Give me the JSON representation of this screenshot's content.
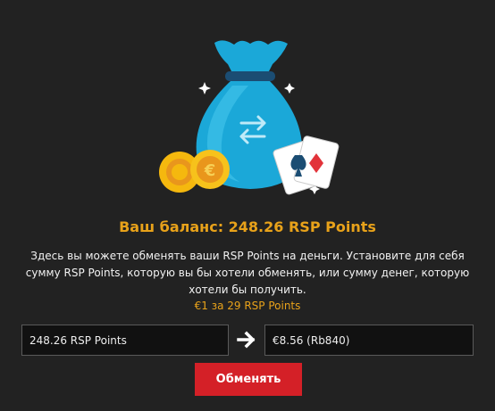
{
  "balance": {
    "title": "Ваш баланс: 248.26 RSP Points"
  },
  "description": "Здесь вы можете обменять ваши RSP Points на деньги. Установите для себя сумму RSP Points, которую вы бы хотели обменять, или сумму денег, которую хотели бы получить.",
  "rate": "€1 за 29 RSP Points",
  "exchange": {
    "points_value": "248.26 RSP Points",
    "money_value": "€8.56 (Rb840)",
    "button_label": "Обменять"
  },
  "icons": {
    "illustration": "money-bag-icon",
    "coins": "coins-icon",
    "cards": "playing-cards-icon",
    "arrow": "arrow-right-icon"
  },
  "colors": {
    "background": "#222222",
    "accent_orange": "#e8a21a",
    "button_red": "#d42027",
    "bag_blue": "#1ba8d8"
  }
}
